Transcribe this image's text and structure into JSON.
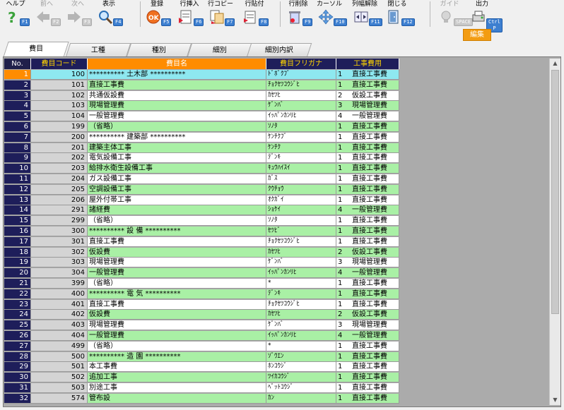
{
  "toolbar": {
    "buttons": [
      {
        "label": "ヘルプ",
        "key": "F1",
        "icon": "help-icon",
        "enabled": true
      },
      {
        "label": "前へ",
        "key": "F2",
        "icon": "back-arrow-icon",
        "enabled": false
      },
      {
        "label": "次へ",
        "key": "F3",
        "icon": "forward-arrow-icon",
        "enabled": false
      },
      {
        "label": "表示",
        "key": "F4",
        "icon": "magnifier-icon",
        "enabled": true
      },
      {
        "label": "登録",
        "key": "F5",
        "icon": "ok-icon",
        "enabled": true
      },
      {
        "label": "行挿入",
        "key": "F6",
        "icon": "insert-row-icon",
        "enabled": true
      },
      {
        "label": "行コピー",
        "key": "F7",
        "icon": "copy-row-icon",
        "enabled": true
      },
      {
        "label": "行貼付",
        "key": "F8",
        "icon": "paste-row-icon",
        "enabled": true
      },
      {
        "label": "行削除",
        "key": "F9",
        "icon": "delete-row-icon",
        "enabled": true
      },
      {
        "label": "カーソル",
        "key": "F10",
        "icon": "cursor-icon",
        "enabled": true
      },
      {
        "label": "列幅解除",
        "key": "F11",
        "icon": "column-width-icon",
        "enabled": true
      },
      {
        "label": "閉じる",
        "key": "F12",
        "icon": "close-door-icon",
        "enabled": true
      },
      {
        "label": "ガイド",
        "key": "SPACE",
        "icon": "guide-bulb-icon",
        "enabled": false
      },
      {
        "label": "出力",
        "key": "Ctrl P",
        "icon": "output-icon",
        "enabled": true
      }
    ],
    "mode_badge": "編集"
  },
  "tabs": [
    {
      "label": "費目",
      "active": true
    },
    {
      "label": "工種",
      "active": false
    },
    {
      "label": "種別",
      "active": false
    },
    {
      "label": "細別",
      "active": false
    },
    {
      "label": "細別内訳",
      "active": false
    }
  ],
  "grid": {
    "headers": {
      "no": "No.",
      "code": "費目コード",
      "name": "費目名",
      "kana": "費目フリガナ",
      "type": "工事費用"
    },
    "rows": [
      {
        "no": "1",
        "code": "100",
        "name": "**********  土木部  **********",
        "kana": "ﾄﾞﾎﾞｸﾌﾞ",
        "tno": "1",
        "type": "直接工事費"
      },
      {
        "no": "2",
        "code": "101",
        "name": "直接工事費",
        "kana": "ﾁｮｸｾﾂｺｳｼﾞﾋ",
        "tno": "1",
        "type": "直接工事費"
      },
      {
        "no": "3",
        "code": "102",
        "name": "共通仮設費",
        "kana": "ｶｾﾂﾋ",
        "tno": "2",
        "type": "仮設工事費"
      },
      {
        "no": "4",
        "code": "103",
        "name": "現場管理費",
        "kana": "ｹﾞﾝﾊﾞ",
        "tno": "3",
        "type": "現場管理費"
      },
      {
        "no": "5",
        "code": "104",
        "name": "一般管理費",
        "kana": "ｲｯﾊﾟﾝｶﾝﾘﾋ",
        "tno": "4",
        "type": "一般管理費"
      },
      {
        "no": "6",
        "code": "199",
        "name": "（省略）",
        "kana": "ｿﾉﾀ",
        "tno": "1",
        "type": "直接工事費"
      },
      {
        "no": "7",
        "code": "200",
        "name": "**********  建築部  **********",
        "kana": "ｹﾝﾁｸﾌﾞ",
        "tno": "1",
        "type": "直接工事費"
      },
      {
        "no": "8",
        "code": "201",
        "name": "建築主体工事",
        "kana": "ｹﾝﾁｸ",
        "tno": "1",
        "type": "直接工事費"
      },
      {
        "no": "9",
        "code": "202",
        "name": "電気設備工事",
        "kana": "ﾃﾞﾝｷ",
        "tno": "1",
        "type": "直接工事費"
      },
      {
        "no": "10",
        "code": "203",
        "name": "給排水衛生設備工事",
        "kana": "ｷｭｳﾊｲｽｲ",
        "tno": "1",
        "type": "直接工事費"
      },
      {
        "no": "11",
        "code": "204",
        "name": "ガス設備工事",
        "kana": "ｶﾞｽ",
        "tno": "1",
        "type": "直接工事費"
      },
      {
        "no": "12",
        "code": "205",
        "name": "空調設備工事",
        "kana": "ｸｳﾁｮｳ",
        "tno": "1",
        "type": "直接工事費"
      },
      {
        "no": "13",
        "code": "206",
        "name": "屋外付帯工事",
        "kana": "ｵｸｶﾞｲ",
        "tno": "1",
        "type": "直接工事費"
      },
      {
        "no": "14",
        "code": "291",
        "name": "諸経費",
        "kana": "ｼｮｹｲ",
        "tno": "4",
        "type": "一般管理費"
      },
      {
        "no": "15",
        "code": "299",
        "name": "（省略）",
        "kana": "ｿﾉﾀ",
        "tno": "1",
        "type": "直接工事費"
      },
      {
        "no": "16",
        "code": "300",
        "name": "**********  設  備  **********",
        "kana": "ｾﾂﾋﾞ",
        "tno": "1",
        "type": "直接工事費"
      },
      {
        "no": "17",
        "code": "301",
        "name": "直接工事費",
        "kana": "ﾁｮｸｾﾂｺｳｼﾞﾋ",
        "tno": "1",
        "type": "直接工事費"
      },
      {
        "no": "18",
        "code": "302",
        "name": "仮設費",
        "kana": "ｶｾﾂﾋ",
        "tno": "2",
        "type": "仮設工事費"
      },
      {
        "no": "19",
        "code": "303",
        "name": "現場管理費",
        "kana": "ｹﾞﾝﾊﾞ",
        "tno": "3",
        "type": "現場管理費"
      },
      {
        "no": "20",
        "code": "304",
        "name": "一般管理費",
        "kana": "ｲｯﾊﾟﾝｶﾝﾘﾋ",
        "tno": "4",
        "type": "一般管理費"
      },
      {
        "no": "21",
        "code": "399",
        "name": "（省略）",
        "kana": "*",
        "tno": "1",
        "type": "直接工事費"
      },
      {
        "no": "22",
        "code": "400",
        "name": "**********  電  気  **********",
        "kana": "ﾃﾞﾝｷ",
        "tno": "1",
        "type": "直接工事費"
      },
      {
        "no": "23",
        "code": "401",
        "name": "直接工事費",
        "kana": "ﾁｮｸｾﾂｺｳｼﾞﾋ",
        "tno": "1",
        "type": "直接工事費"
      },
      {
        "no": "24",
        "code": "402",
        "name": "仮設費",
        "kana": "ｶｾﾂﾋ",
        "tno": "2",
        "type": "仮設工事費"
      },
      {
        "no": "25",
        "code": "403",
        "name": "現場管理費",
        "kana": "ｹﾞﾝﾊﾞ",
        "tno": "3",
        "type": "現場管理費"
      },
      {
        "no": "26",
        "code": "404",
        "name": "一般管理費",
        "kana": "ｲｯﾊﾟﾝｶﾝﾘﾋ",
        "tno": "4",
        "type": "一般管理費"
      },
      {
        "no": "27",
        "code": "499",
        "name": "（省略）",
        "kana": "*",
        "tno": "1",
        "type": "直接工事費"
      },
      {
        "no": "28",
        "code": "500",
        "name": "**********  造  園  **********",
        "kana": "ｿﾞｳｴﾝ",
        "tno": "1",
        "type": "直接工事費"
      },
      {
        "no": "29",
        "code": "501",
        "name": "本工事費",
        "kana": "ﾎﾝｺｳｼﾞ",
        "tno": "1",
        "type": "直接工事費"
      },
      {
        "no": "30",
        "code": "502",
        "name": "追加工事",
        "kana": "ﾂｲｶｺｳｼﾞ",
        "tno": "1",
        "type": "直接工事費"
      },
      {
        "no": "31",
        "code": "503",
        "name": "別途工事",
        "kana": "ﾍﾞｯﾄｺｳｼﾞ",
        "tno": "1",
        "type": "直接工事費"
      },
      {
        "no": "32",
        "code": "574",
        "name": "管布設",
        "kana": "ｶﾝ",
        "tno": "1",
        "type": "直接工事費"
      }
    ]
  }
}
